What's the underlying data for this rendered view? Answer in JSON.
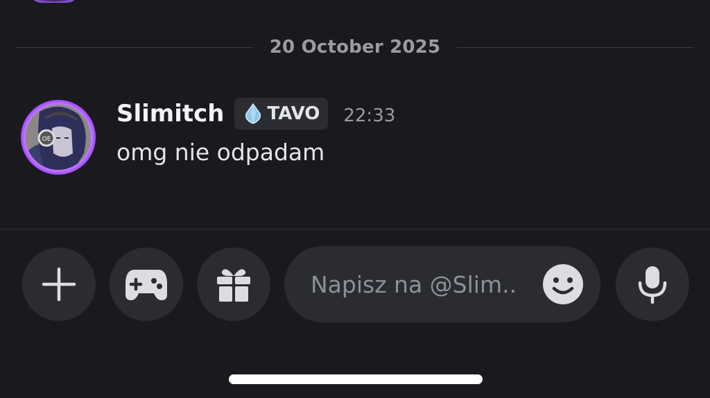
{
  "chat": {
    "date_divider": "20 October 2025",
    "message": {
      "username": "Slimitch",
      "role_tag": "TAVO",
      "timestamp": "22:33",
      "text": "omg nie odpadam"
    }
  },
  "composer": {
    "placeholder": "Napisz na @Slim..",
    "value": "",
    "buttons": {
      "add": "plus-icon",
      "activities": "gamepad-icon",
      "gift": "gift-icon",
      "emoji": "emoji-icon",
      "voice": "microphone-icon"
    }
  },
  "colors": {
    "background": "#1a1a1e",
    "surface": "#2b2c31",
    "text_primary": "#f2f3f5",
    "text_muted": "#9b9ca3",
    "avatar_ring": "#a24bff",
    "role_gem": "#8fc7e6"
  }
}
